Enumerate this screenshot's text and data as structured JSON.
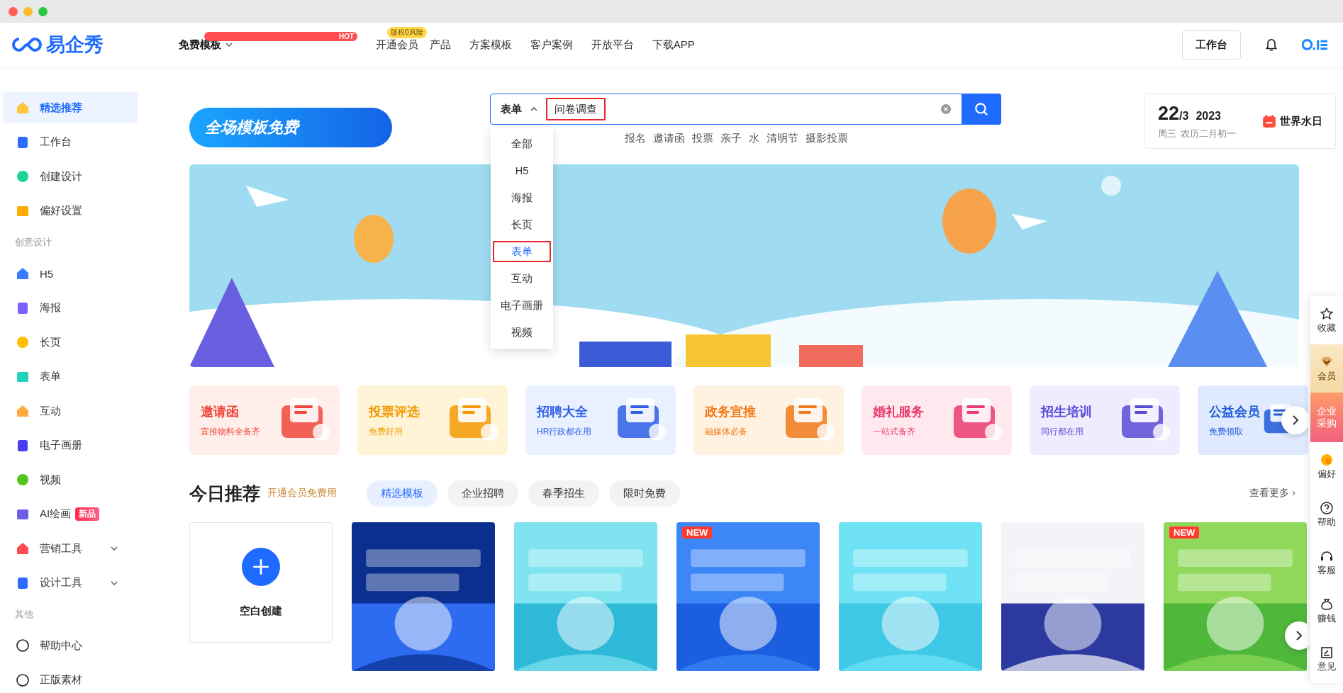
{
  "header": {
    "logo": "易企秀",
    "nav": [
      {
        "label": "免费模板",
        "selected": true,
        "badge": "HOT",
        "badge_highlight": true,
        "expanded": false
      },
      {
        "label": "开通会员",
        "selected": false,
        "badge": "版权0风险",
        "badge_highlight": false
      },
      {
        "label": "产品",
        "selected": false
      },
      {
        "label": "方案模板",
        "selected": false
      },
      {
        "label": "客户案例",
        "selected": false
      },
      {
        "label": "开放平台",
        "selected": false
      },
      {
        "label": "下载APP",
        "selected": false
      }
    ],
    "workspace_button": "工作台"
  },
  "sidebar": {
    "groups": [
      {
        "items": [
          {
            "label": "精选推荐",
            "selected": true
          },
          {
            "label": "工作台",
            "selected": false
          },
          {
            "label": "创建设计",
            "selected": false
          },
          {
            "label": "偏好设置",
            "selected": false
          }
        ]
      },
      {
        "heading": "创意设计",
        "items": [
          {
            "label": "H5",
            "selected": false
          },
          {
            "label": "海报",
            "selected": false
          },
          {
            "label": "长页",
            "selected": false
          },
          {
            "label": "表单",
            "selected": false
          },
          {
            "label": "互动",
            "selected": false
          },
          {
            "label": "电子画册",
            "selected": false
          },
          {
            "label": "视频",
            "selected": false
          },
          {
            "label": "AI绘画",
            "selected": false,
            "badge": "新品"
          },
          {
            "label": "营销工具",
            "selected": false,
            "expanded": false
          },
          {
            "label": "设计工具",
            "selected": false,
            "expanded": false
          }
        ]
      },
      {
        "heading": "其他",
        "items": [
          {
            "label": "帮助中心",
            "selected": false
          },
          {
            "label": "正版素材",
            "selected": false
          }
        ]
      }
    ]
  },
  "promo": {
    "label": "全场模板免费"
  },
  "search": {
    "category": "表单",
    "expanded": true,
    "value": "问卷调查",
    "highlighted": true,
    "options": [
      {
        "label": "全部",
        "selected": false
      },
      {
        "label": "H5",
        "selected": false
      },
      {
        "label": "海报",
        "selected": false
      },
      {
        "label": "长页",
        "selected": false
      },
      {
        "label": "表单",
        "selected": true
      },
      {
        "label": "互动",
        "selected": false
      },
      {
        "label": "电子画册",
        "selected": false
      },
      {
        "label": "视频",
        "selected": false
      }
    ],
    "hot_words": [
      "报名",
      "邀请函",
      "投票",
      "亲子",
      "水",
      "清明节",
      "摄影投票"
    ]
  },
  "date_card": {
    "day": "22",
    "month": "/3",
    "year": "2023",
    "weekday": "周三",
    "lunar": "农历二月初一",
    "festival": "世界水日"
  },
  "banner": {
    "kind": "picture"
  },
  "categories": [
    {
      "title": "邀请函",
      "subtitle": "宣推物料全备齐",
      "color": "#f0463c"
    },
    {
      "title": "投票评选",
      "subtitle": "免费好用",
      "color": "#f29a05"
    },
    {
      "title": "招聘大全",
      "subtitle": "HR行政都在用",
      "color": "#2f5fe6"
    },
    {
      "title": "政务宣推",
      "subtitle": "融媒体必备",
      "color": "#f07a1a"
    },
    {
      "title": "婚礼服务",
      "subtitle": "一站式备齐",
      "color": "#ea3c6e"
    },
    {
      "title": "招生培训",
      "subtitle": "同行都在用",
      "color": "#5a4bd6"
    },
    {
      "title": "公益会员",
      "subtitle": "免费领取",
      "color": "#1f5bd8"
    }
  ],
  "today": {
    "title": "今日推荐",
    "subtitle": "开通会员免费用",
    "tabs": [
      {
        "label": "精选模板",
        "selected": true
      },
      {
        "label": "企业招聘",
        "selected": false
      },
      {
        "label": "春季招生",
        "selected": false
      },
      {
        "label": "限时免费",
        "selected": false
      }
    ],
    "more_link": "查看更多 ›",
    "templates": [
      {
        "kind": "blank",
        "label": "空白创建"
      },
      {
        "kind": "picture"
      },
      {
        "kind": "picture"
      },
      {
        "kind": "picture",
        "badge": "NEW"
      },
      {
        "kind": "picture"
      },
      {
        "kind": "picture"
      },
      {
        "kind": "picture",
        "badge": "NEW"
      }
    ]
  },
  "float_bar": [
    {
      "label": "收藏",
      "kind": "plain"
    },
    {
      "label": "会员",
      "kind": "vip"
    },
    {
      "label": "企业采购",
      "kind": "enterprise"
    },
    {
      "label": "偏好",
      "kind": "plain"
    },
    {
      "label": "帮助",
      "kind": "plain"
    },
    {
      "label": "客服",
      "kind": "plain"
    },
    {
      "label": "赚钱",
      "kind": "plain"
    },
    {
      "label": "意见",
      "kind": "plain"
    }
  ]
}
